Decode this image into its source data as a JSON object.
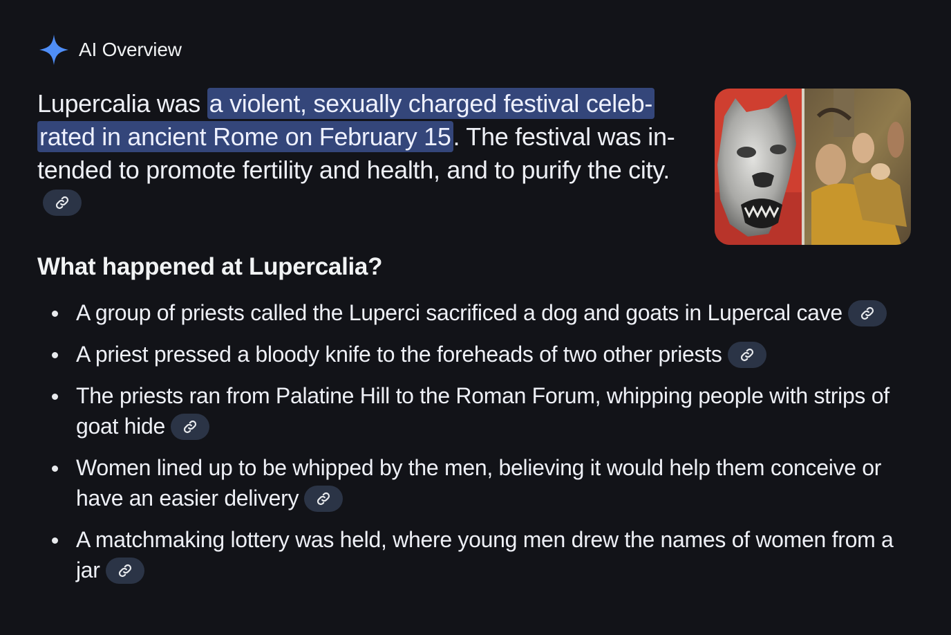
{
  "header": {
    "title": "AI Overview",
    "icon": "sparkle-icon",
    "icon_color": "#4f8ef7"
  },
  "intro": {
    "before": "Lupercalia was ",
    "highlight": "a violent, sexually charged festival celeb-rated in ancient Rome on February 15",
    "after": ". The festival was in-tended to promote fertility and health, and to purify the city.",
    "highlight_color": "#34467a"
  },
  "section": {
    "heading": "What happened at Lupercalia?",
    "bullets": [
      {
        "text": "A group of priests called the Luperci sacrificed a dog and goats in Lupercal cave"
      },
      {
        "text": "A priest pressed a bloody knife to the foreheads of two other priests"
      },
      {
        "text": "The priests ran from Palatine Hill to the Roman Forum, whipping people with strips of goat hide"
      },
      {
        "text": "Women lined up to be whipped by the men, believing it would help them conceive or have an easier delivery"
      },
      {
        "text": "A matchmaking lottery was held, where young men drew the names of women from a jar"
      }
    ]
  },
  "colors": {
    "background": "#121318",
    "text": "#eef0f6",
    "link_chip": "#2b3446",
    "link_icon": "#e8eaed"
  },
  "icons": {
    "link": "link-icon"
  }
}
